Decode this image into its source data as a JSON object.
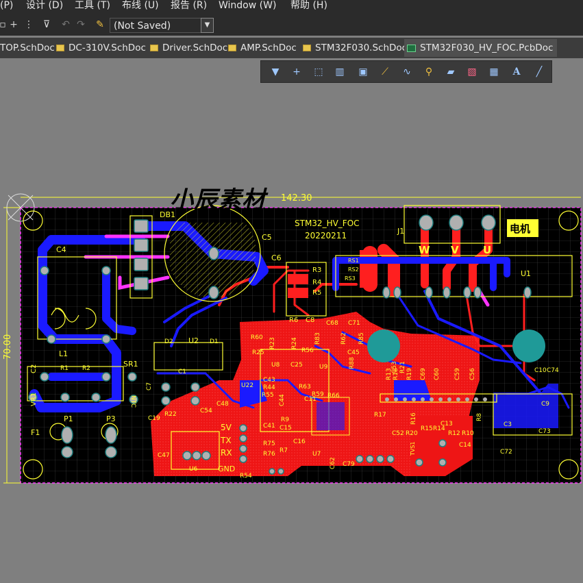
{
  "menu": {
    "items": [
      "(P)",
      "设计 (D)",
      "工具 (T)",
      "布线 (U)",
      "报告 (R)",
      "Window (W)",
      "帮助 (H)"
    ]
  },
  "toolbar": {
    "combo_value": "(Not Saved)"
  },
  "tabs": [
    {
      "label": "TOP.SchDoc",
      "type": "sch"
    },
    {
      "label": "DC-310V.SchDoc",
      "type": "sch"
    },
    {
      "label": "Driver.SchDoc",
      "type": "sch"
    },
    {
      "label": "AMP.SchDoc",
      "type": "sch"
    },
    {
      "label": "STM32F030.SchDoc",
      "type": "sch"
    },
    {
      "label": "STM32F030_HV_FOC.PcbDoc",
      "type": "pcb",
      "active": true
    }
  ],
  "board": {
    "watermark": "小辰素材",
    "dim_width": "142.30",
    "dim_height": "70.00",
    "silk_title": "STM32_HV_FOC",
    "silk_date": "20220211",
    "motor_label": "电机",
    "phase_w": "W",
    "phase_v": "V",
    "phase_u": "U",
    "serial_5v": "5V",
    "serial_tx": "TX",
    "serial_rx": "RX",
    "serial_gnd": "GND",
    "refdes": {
      "DB1": "DB1",
      "C5": "C5",
      "J1": "J1",
      "U1": "U1",
      "C4": "C4",
      "C6": "C6",
      "R3": "R3",
      "R4": "R4",
      "R5": "R5",
      "R6": "R6",
      "C8": "C8",
      "RS1": "RS1",
      "RS2": "RS2",
      "RS3": "RS3",
      "L1": "L1",
      "C2": "C2",
      "R1": "R1",
      "R2": "R2",
      "SR1": "SR1",
      "NTC": "NTC",
      "VR1": "VR1",
      "F1": "F1",
      "P1": "P1",
      "P3": "P3",
      "D1": "D1",
      "D2": "D2",
      "U2": "U2",
      "C1": "C1",
      "C7": "C7",
      "C19": "C19",
      "R22": "R22",
      "C47": "C47",
      "U6": "U6",
      "C54": "C54",
      "C48": "C48",
      "U22": "U22",
      "R60": "R60",
      "R25": "R25",
      "U8": "U8",
      "C43": "C43",
      "R44": "R44",
      "R55": "R55",
      "C10": "C10",
      "C74": "C74",
      "C9": "C9",
      "C73": "C73",
      "C3": "C3",
      "C72": "C72",
      "C14": "C14",
      "TVS1": "TVS1",
      "C79": "C79",
      "R54": "R54",
      "R17": "R17",
      "C52": "C52",
      "R20": "R20",
      "R15": "R15",
      "R14": "R14",
      "R12": "R12",
      "R10": "R10",
      "R8": "R8",
      "C13": "C13",
      "R16": "R16",
      "C59": "C59",
      "C56": "C56",
      "C69": "C69",
      "C60": "C60",
      "R13": "R13",
      "R19": "R19",
      "R21": "R21",
      "R18": "R18",
      "C68": "C68",
      "C71": "C71",
      "R85": "R85",
      "C45": "C45",
      "R88": "R88",
      "R56": "R56",
      "U9": "U9",
      "R66": "R66",
      "C11": "C11",
      "R59": "R59",
      "R63": "R63",
      "R9": "R9",
      "C15": "C15",
      "C41": "C41",
      "C16": "C16",
      "R75": "R75",
      "R76": "R76",
      "R7": "R7",
      "U7": "U7",
      "C62": "C62",
      "R23": "R23",
      "R24": "R24",
      "R83": "R83",
      "R62": "R62",
      "C25": "C25",
      "C44": "C44",
      "C53": "C53"
    }
  },
  "colors": {
    "board_bg": "#000000",
    "top_copper": "#ff1f1f",
    "bottom_copper": "#1a1aff",
    "silkscreen": "#ffff33",
    "pad": "#b0b0b0",
    "via": "#1f9a98",
    "edge": "#ff33ff"
  }
}
